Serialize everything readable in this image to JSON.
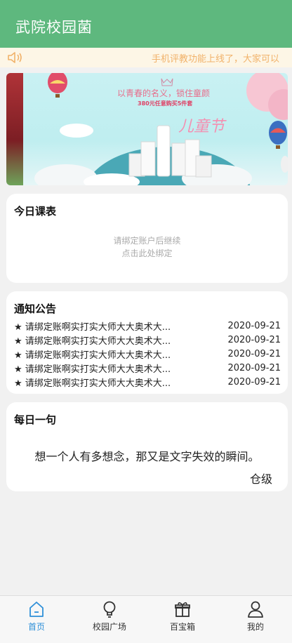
{
  "header": {
    "title": "武院校园菌"
  },
  "notice_bar": {
    "icon": "speaker-icon",
    "text": "手机评教功能上线了，大家可以"
  },
  "banner": {
    "line1": "以青春的名义，锁住童颜",
    "line2": "380元任意购买5件套",
    "festival": "儿童节"
  },
  "schedule": {
    "title": "今日课表",
    "hint1": "请绑定账户后继续",
    "hint2": "点击此处绑定"
  },
  "notices": {
    "title": "通知公告",
    "items": [
      {
        "text": "★ 请绑定账啊实打实大师大大奥术大...",
        "date": "2020-09-21"
      },
      {
        "text": "★ 请绑定账啊实打实大师大大奥术大...",
        "date": "2020-09-21"
      },
      {
        "text": "★ 请绑定账啊实打实大师大大奥术大...",
        "date": "2020-09-21"
      },
      {
        "text": "★ 请绑定账啊实打实大师大大奥术大...",
        "date": "2020-09-21"
      },
      {
        "text": "★ 请绑定账啊实打实大师大大奥术大...",
        "date": "2020-09-21"
      }
    ]
  },
  "daily": {
    "title": "每日一句",
    "sentence": "想一个人有多想念，那又是文字失效的瞬间。",
    "author": "仓级"
  },
  "tabbar": {
    "active_color": "#2e8fd8",
    "items": [
      {
        "label": "首页",
        "icon": "home-icon",
        "active": true
      },
      {
        "label": "校园广场",
        "icon": "bulb-icon",
        "active": false
      },
      {
        "label": "百宝箱",
        "icon": "gift-icon",
        "active": false
      },
      {
        "label": "我的",
        "icon": "user-icon",
        "active": false
      }
    ]
  },
  "colors": {
    "header": "#5eb87e",
    "notice_text": "#f1b26a",
    "notice_bg": "#fdf6e6"
  }
}
